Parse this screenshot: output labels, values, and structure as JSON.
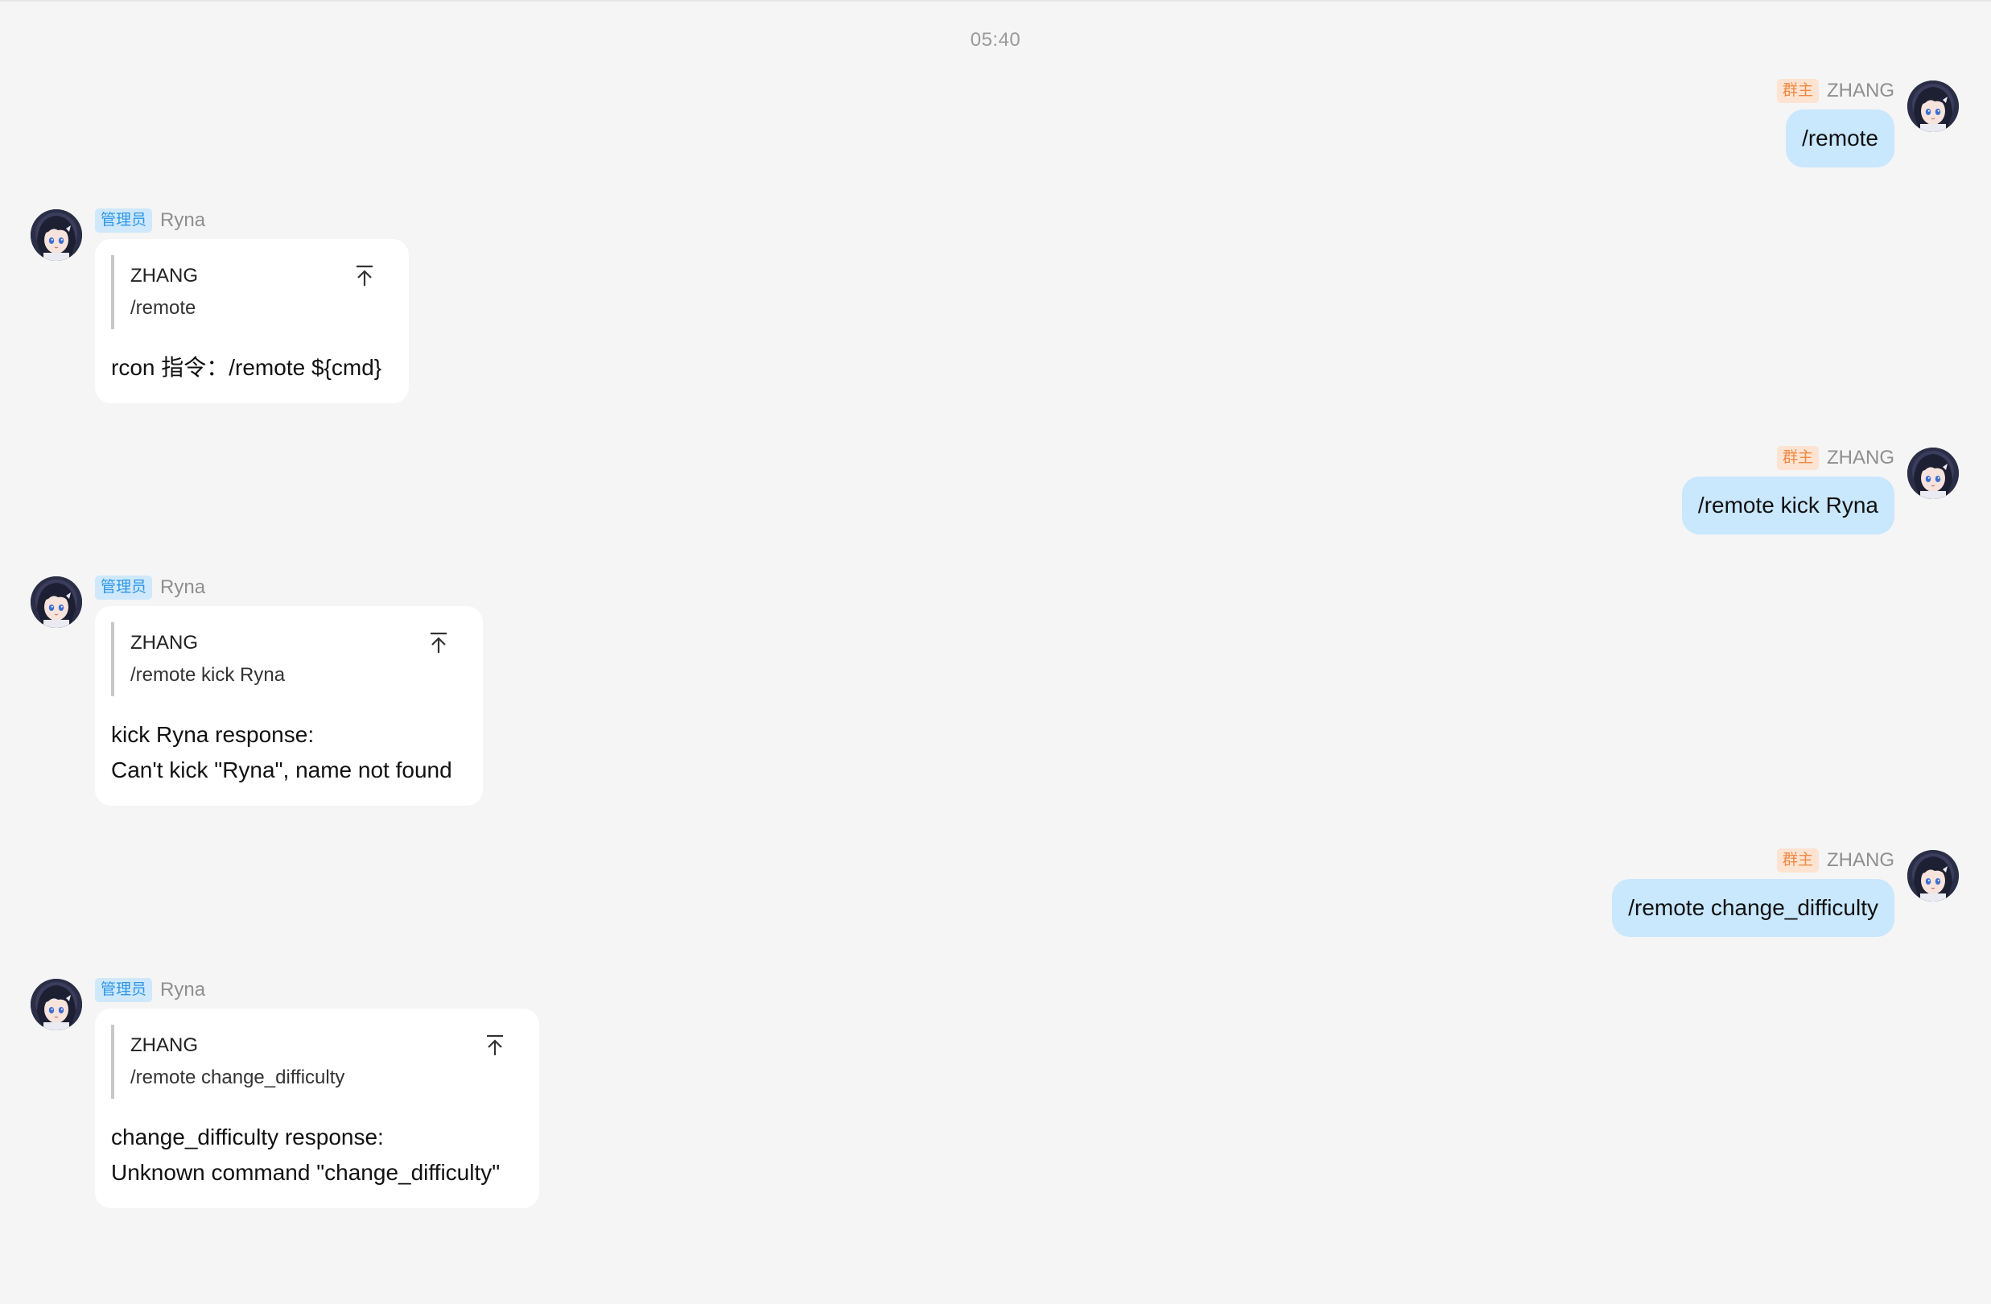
{
  "chat": {
    "timestamp": "05:40",
    "messages": [
      {
        "direction": "out",
        "role_badge": "群主",
        "sender": "ZHANG",
        "text": "/remote"
      },
      {
        "direction": "in",
        "role_badge": "管理员",
        "sender": "Ryna",
        "quote": {
          "author": "ZHANG",
          "text": "/remote"
        },
        "lines": [
          "rcon 指令：/remote ${cmd}"
        ]
      },
      {
        "direction": "out",
        "role_badge": "群主",
        "sender": "ZHANG",
        "text": "/remote kick Ryna"
      },
      {
        "direction": "in",
        "role_badge": "管理员",
        "sender": "Ryna",
        "quote": {
          "author": "ZHANG",
          "text": "/remote kick Ryna"
        },
        "lines": [
          "kick Ryna response:",
          "Can't kick \"Ryna\", name not found"
        ]
      },
      {
        "direction": "out",
        "role_badge": "群主",
        "sender": "ZHANG",
        "text": "/remote change_difficulty"
      },
      {
        "direction": "in",
        "role_badge": "管理员",
        "sender": "Ryna",
        "quote": {
          "author": "ZHANG",
          "text": "/remote change_difficulty"
        },
        "lines": [
          "change_difficulty response:",
          "Unknown command \"change_difficulty\""
        ]
      }
    ]
  },
  "icons": {
    "jump_to_message": "arrow-to-top-icon",
    "avatar": "anime-avatar-image"
  },
  "colors": {
    "background": "#f5f5f5",
    "outgoing_bubble": "#c9e7fd",
    "incoming_bubble": "#ffffff",
    "owner_badge_bg": "#fde3d1",
    "owner_badge_text": "#ee8a44",
    "admin_badge_bg": "#cfe8fb",
    "admin_badge_text": "#2c97e5"
  }
}
